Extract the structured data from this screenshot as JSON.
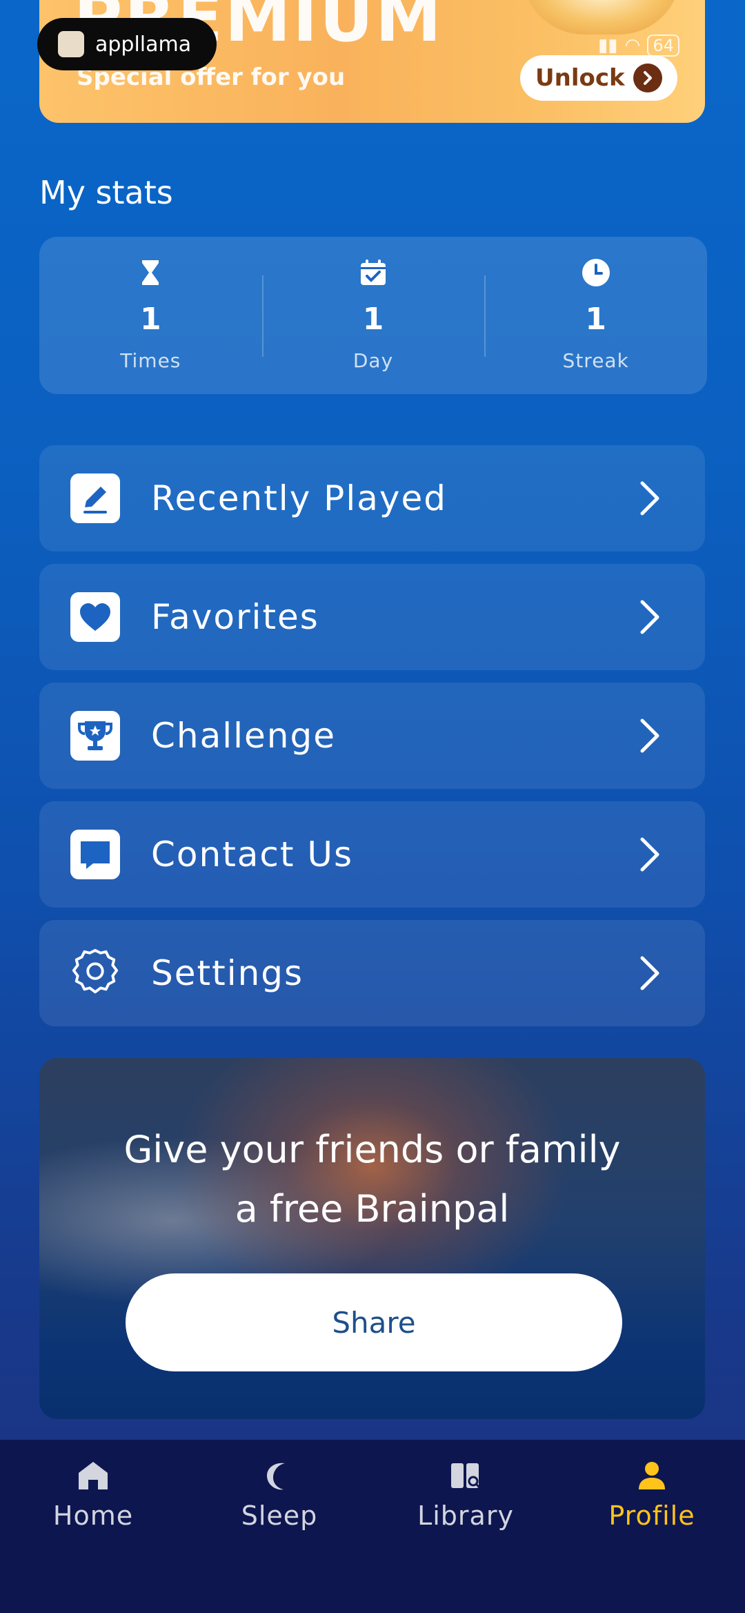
{
  "banner": {
    "title": "PREMIUM",
    "subtitle": "Special offer for you",
    "unlock_label": "Unlock",
    "battery": "64"
  },
  "badge": {
    "text": "appllama"
  },
  "stats_section": {
    "title": "My stats",
    "items": [
      {
        "icon": "hourglass-icon",
        "value": "1",
        "label": "Times"
      },
      {
        "icon": "calendar-check-icon",
        "value": "1",
        "label": "Day"
      },
      {
        "icon": "clock-icon",
        "value": "1",
        "label": "Streak"
      }
    ]
  },
  "menu": [
    {
      "icon": "edit-icon",
      "label": "Recently Played"
    },
    {
      "icon": "heart-icon",
      "label": "Favorites"
    },
    {
      "icon": "trophy-icon",
      "label": "Challenge"
    },
    {
      "icon": "chat-icon",
      "label": "Contact Us"
    },
    {
      "icon": "gear-icon",
      "label": "Settings"
    }
  ],
  "share_card": {
    "line1": "Give your friends or family",
    "line2": "a free Brainpal",
    "button_label": "Share"
  },
  "bottom_nav": {
    "items": [
      {
        "icon": "home-icon",
        "label": "Home"
      },
      {
        "icon": "moon-icon",
        "label": "Sleep"
      },
      {
        "icon": "library-icon",
        "label": "Library"
      },
      {
        "icon": "profile-icon",
        "label": "Profile"
      }
    ],
    "active": "Profile",
    "active_color": "#ffc31a"
  }
}
